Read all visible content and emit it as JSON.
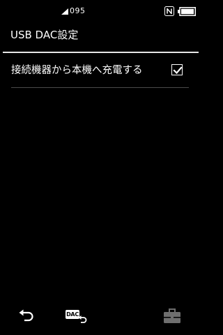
{
  "status_bar": {
    "volume_value": "095",
    "volume_icon": "volume-icon",
    "nfc_icon": "nfc-icon",
    "battery_icon": "battery-icon",
    "battery_level": 0.9
  },
  "header": {
    "title": "USB DAC設定"
  },
  "settings": [
    {
      "label": "接続機器から本機へ充電する",
      "checked": true
    }
  ],
  "bottom_bar": {
    "back_icon": "back-icon",
    "dac_badge_text": "DAC",
    "dac_icon": "dac-return-icon",
    "toolbox_icon": "toolbox-icon"
  },
  "colors": {
    "background": "#000000",
    "text": "#ffffff",
    "toolbox_disabled": "#6e6e6e",
    "divider": "#e6e6e6"
  }
}
